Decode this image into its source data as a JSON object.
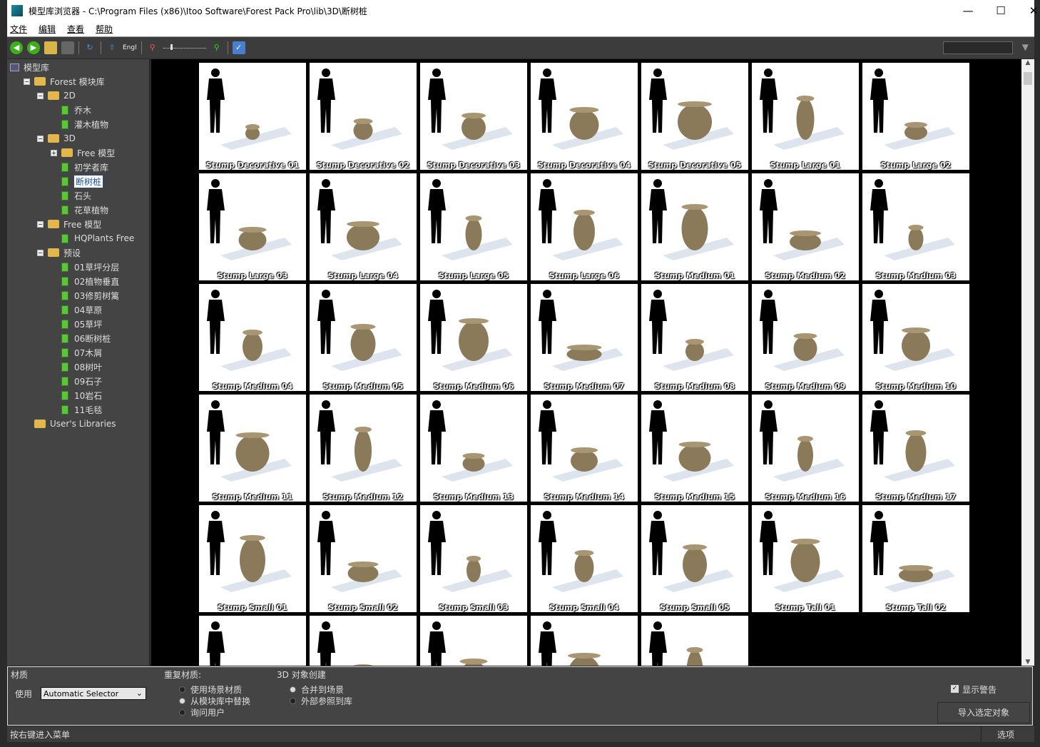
{
  "window": {
    "title": "模型库浏览器 - C:\\Program Files (x86)\\Itoo Software\\Forest Pack Pro\\lib\\3D\\断树桩",
    "minimize": "—",
    "maximize": "☐",
    "close": "✕"
  },
  "menu": [
    "文件",
    "编辑",
    "查看",
    "帮助"
  ],
  "toolbar": {
    "lang_label": "Engl"
  },
  "tree": [
    {
      "label": "模型库",
      "level": 0,
      "type": "root"
    },
    {
      "label": "Forest 模块库",
      "level": 1,
      "type": "folder",
      "exp": "−"
    },
    {
      "label": "2D",
      "level": 2,
      "type": "folder",
      "exp": "−"
    },
    {
      "label": "乔木",
      "level": 3,
      "type": "leaf"
    },
    {
      "label": "灌木植物",
      "level": 3,
      "type": "leaf"
    },
    {
      "label": "3D",
      "level": 2,
      "type": "folder",
      "exp": "−"
    },
    {
      "label": "Free 模型",
      "level": 3,
      "type": "folder",
      "exp": "+"
    },
    {
      "label": "初学者库",
      "level": 3,
      "type": "leaf"
    },
    {
      "label": "断树桩",
      "level": 3,
      "type": "leaf",
      "selected": true
    },
    {
      "label": "石头",
      "level": 3,
      "type": "leaf"
    },
    {
      "label": "花草植物",
      "level": 3,
      "type": "leaf"
    },
    {
      "label": "Free 模型",
      "level": 2,
      "type": "folder",
      "exp": "−"
    },
    {
      "label": "HQPlants Free",
      "level": 3,
      "type": "leaf"
    },
    {
      "label": "预设",
      "level": 2,
      "type": "folder",
      "exp": "−"
    },
    {
      "label": "01草坪分层",
      "level": 3,
      "type": "leaf"
    },
    {
      "label": "02植物垂直",
      "level": 3,
      "type": "leaf"
    },
    {
      "label": "03修剪树篱",
      "level": 3,
      "type": "leaf"
    },
    {
      "label": "04草原",
      "level": 3,
      "type": "leaf"
    },
    {
      "label": "05草坪",
      "level": 3,
      "type": "leaf"
    },
    {
      "label": "06断树桩",
      "level": 3,
      "type": "leaf"
    },
    {
      "label": "07木屑",
      "level": 3,
      "type": "leaf"
    },
    {
      "label": "08树叶",
      "level": 3,
      "type": "leaf"
    },
    {
      "label": "09石子",
      "level": 3,
      "type": "leaf"
    },
    {
      "label": "10岩石",
      "level": 3,
      "type": "leaf"
    },
    {
      "label": "11毛毯",
      "level": 3,
      "type": "leaf"
    },
    {
      "label": "User's Libraries",
      "level": 1,
      "type": "folder"
    }
  ],
  "items": [
    "Stump Decorative 01",
    "Stump Decorative 02",
    "Stump Decorative 03",
    "Stump Decorative 04",
    "Stump Decorative 05",
    "Stump Large 01",
    "Stump Large 02",
    "Stump Large 03",
    "Stump Large 04",
    "Stump Large 05",
    "Stump Large 06",
    "Stump Medium 01",
    "Stump Medium 02",
    "Stump Medium 03",
    "Stump Medium 04",
    "Stump Medium 05",
    "Stump Medium 06",
    "Stump Medium 07",
    "Stump Medium 08",
    "Stump Medium 09",
    "Stump Medium 10",
    "Stump Medium 11",
    "Stump Medium 12",
    "Stump Medium 13",
    "Stump Medium 14",
    "Stump Medium 15",
    "Stump Medium 16",
    "Stump Medium 17",
    "Stump Small 01",
    "Stump Small 02",
    "Stump Small 03",
    "Stump Small 04",
    "Stump Small 05",
    "Stump Tall 01",
    "Stump Tall 02",
    "",
    "",
    "",
    "",
    ""
  ],
  "bottom": {
    "material_label": "材质",
    "use_label": "使用",
    "material_select": "Automatic Selector",
    "dup_label": "重复材质:",
    "dup_options": [
      "使用场景材质",
      "从模块库中替换",
      "询问用户"
    ],
    "create_label": "3D 对象创建",
    "create_options": [
      "合并到场景",
      "外部参照到库"
    ],
    "show_warning": "显示警告",
    "import_button": "导入选定对象"
  },
  "status": {
    "hint": "按右键进入菜单",
    "options": "选项"
  }
}
